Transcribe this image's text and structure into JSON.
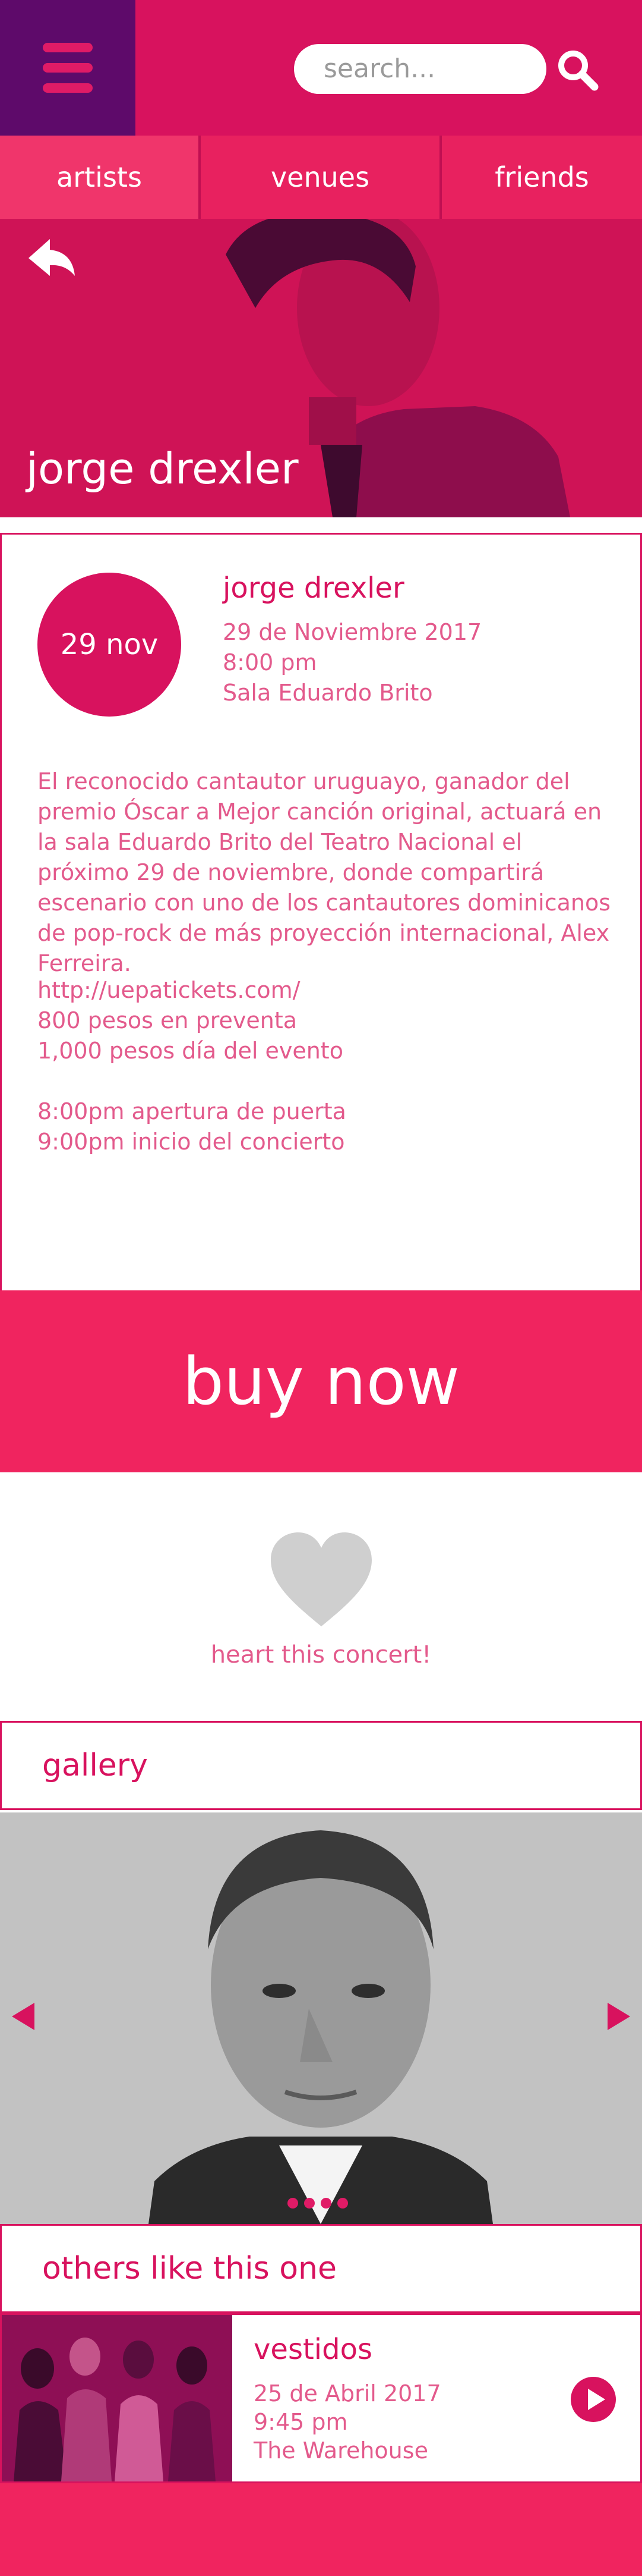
{
  "header": {
    "search_placeholder": "search..."
  },
  "tabs": [
    {
      "label": "artists"
    },
    {
      "label": "venues"
    },
    {
      "label": "friends"
    }
  ],
  "hero": {
    "title": "jorge drexler"
  },
  "event": {
    "date_badge": "29 nov",
    "title": "jorge drexler",
    "date": "29 de Noviembre 2017",
    "time": "8:00 pm",
    "venue": "Sala Eduardo Brito",
    "description": "El reconocido cantautor uruguayo, ganador del premio Óscar a Mejor canción original, actuará en la sala Eduardo Brito del Teatro Nacional  el próximo 29 de noviembre, donde compartirá escenario con uno de los cantautores dominicanos de pop-rock de más proyección internacional, Alex Ferreira.",
    "ticket_url": "http://uepatickets.com/",
    "presale_price": "800 pesos en preventa",
    "door_price": "1,000 pesos día del evento",
    "doors_open": "8:00pm apertura de puerta",
    "concert_start": "9:00pm inicio del concierto"
  },
  "buy_button": {
    "label": "buy now"
  },
  "heart": {
    "label": "heart this concert!"
  },
  "gallery": {
    "title": "gallery"
  },
  "others": {
    "title": "others like this one",
    "items": [
      {
        "title": "vestidos",
        "date": "25 de Abril 2017",
        "time": "9:45 pm",
        "venue": "The Warehouse"
      }
    ]
  },
  "colors": {
    "primary": "#d8125e",
    "accent": "#f0245f",
    "menu_bg": "#5e0a6a",
    "text_light": "#e35a8c"
  }
}
